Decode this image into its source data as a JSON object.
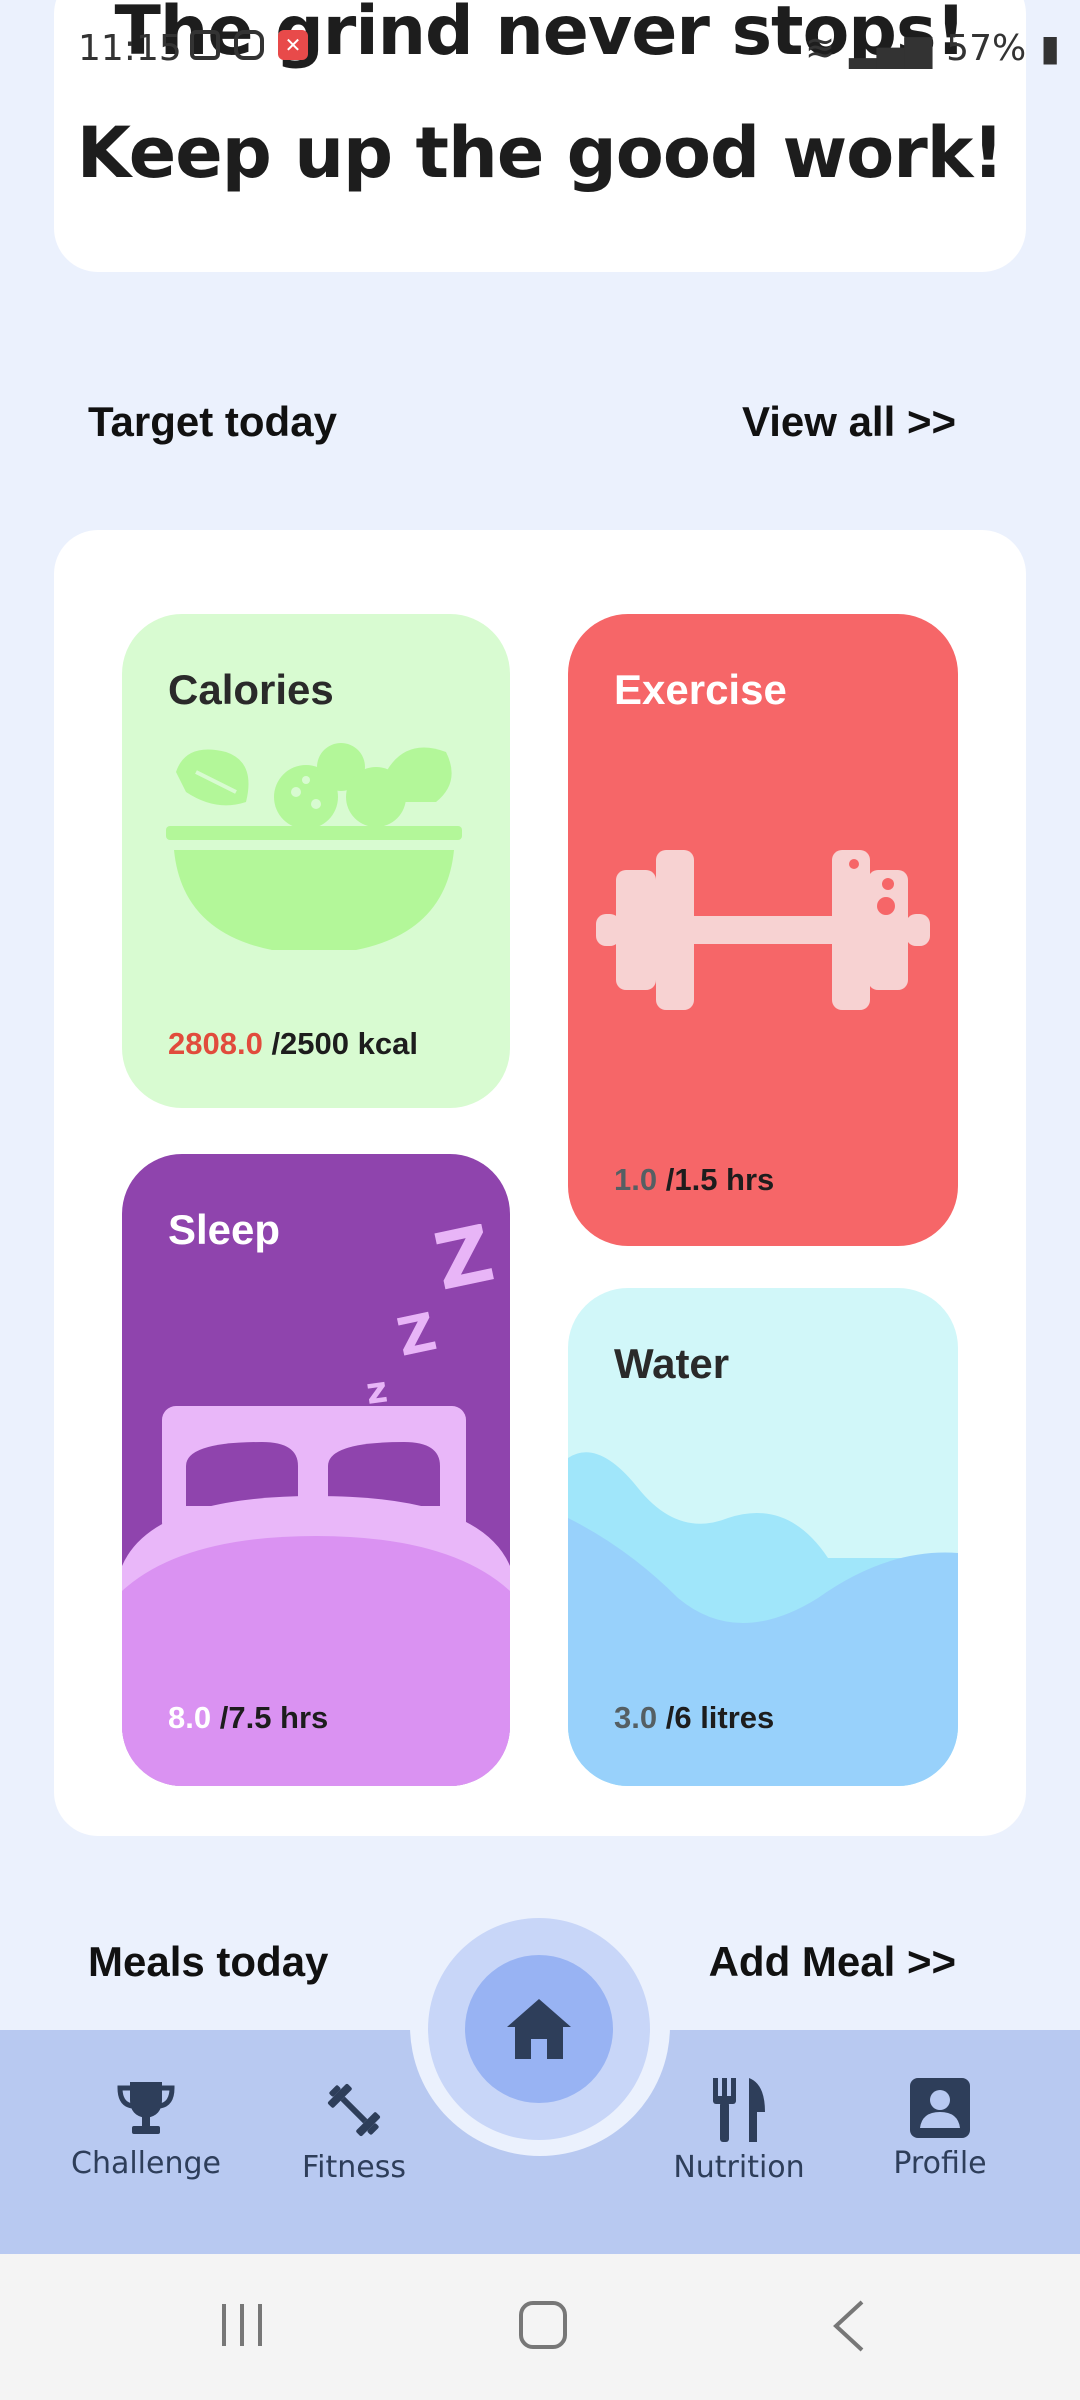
{
  "status_bar": {
    "time": "11:15",
    "battery": "57%"
  },
  "header": {
    "motto_line1": "The grind never stops!",
    "motto_line2": "Keep up the good work!"
  },
  "target_section": {
    "title": "Target today",
    "view_all": "View all >>"
  },
  "tiles": {
    "calories": {
      "title": "Calories",
      "current": "2808.0",
      "total": " /2500 kcal",
      "icon": "salad-bowl-icon"
    },
    "exercise": {
      "title": "Exercise",
      "current": "1.0",
      "total": " /1.5 hrs",
      "icon": "dumbbell-icon"
    },
    "sleep": {
      "title": "Sleep",
      "current": "8.0",
      "total": " /7.5 hrs",
      "icon": "bed-icon"
    },
    "water": {
      "title": "Water",
      "current": "3.0",
      "total": " /6 litres",
      "icon": "wave-icon"
    }
  },
  "meals_section": {
    "title": "Meals today",
    "add_meal": "Add Meal >>"
  },
  "bottom_nav": {
    "items": [
      {
        "label": "Challenge",
        "icon": "trophy-icon"
      },
      {
        "label": "Fitness",
        "icon": "dumbbell-icon"
      },
      {
        "label": "Home",
        "icon": "home-icon"
      },
      {
        "label": "Nutrition",
        "icon": "fork-knife-icon"
      },
      {
        "label": "Profile",
        "icon": "profile-icon"
      }
    ]
  },
  "colors": {
    "background": "#ebf1fd",
    "calories_tile": "#d8fbd1",
    "exercise_tile": "#f66668",
    "sleep_tile": "#8f44ad",
    "water_tile": "#d1f7f9",
    "nav_bar": "#b8c9f1",
    "home_button": "#98b3f3"
  }
}
